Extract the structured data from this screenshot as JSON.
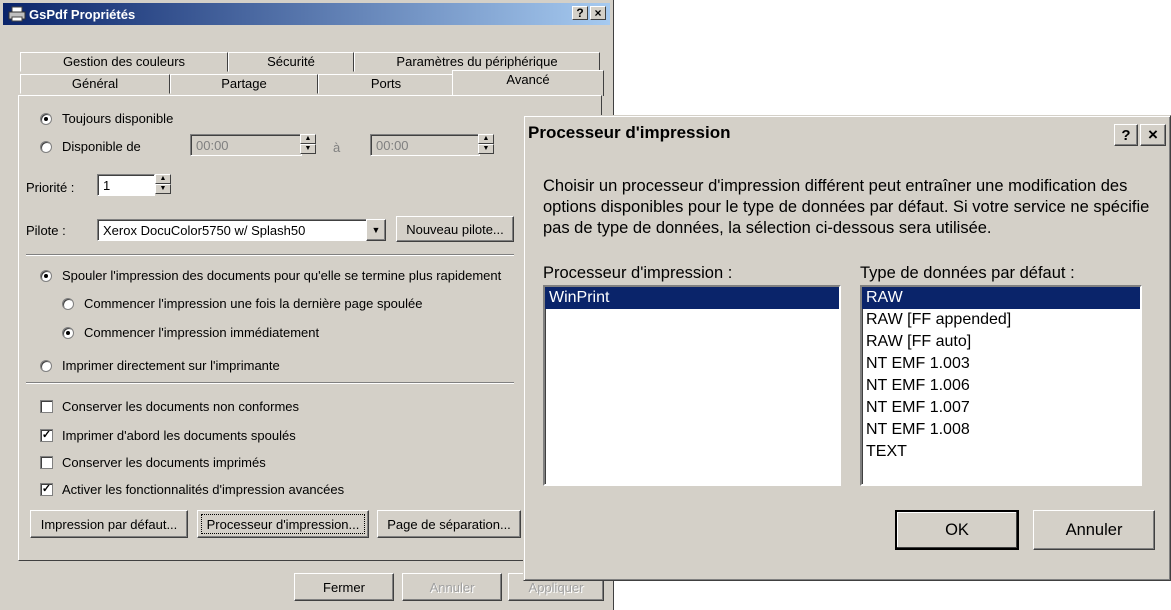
{
  "props": {
    "title": "GsPdf Propriétés",
    "help_btn": "?",
    "close_btn": "×",
    "tabs_row1": [
      "Gestion des couleurs",
      "Sécurité",
      "Paramètres du périphérique"
    ],
    "tabs_row2": [
      "Général",
      "Partage",
      "Ports",
      "Avancé"
    ],
    "always_available": "Toujours disponible",
    "available_from": "Disponible de",
    "time_from": "00:00",
    "time_to_label": "à",
    "time_to": "00:00",
    "priority_label": "Priorité :",
    "priority_value": "1",
    "driver_label": "Pilote :",
    "driver_value": "Xerox DocuColor5750 w/ Splash50",
    "new_driver_button": "Nouveau pilote...",
    "spool_option": "Spouler l'impression des documents pour qu'elle se termine plus rapidement",
    "spool_after_last": "Commencer l'impression une fois la dernière page spoulée",
    "spool_immediately": "Commencer l'impression immédiatement",
    "print_direct": "Imprimer directement sur l'imprimante",
    "keep_mismatched": "Conserver les documents non conformes",
    "print_spooled_first": "Imprimer d'abord les documents spoulés",
    "keep_printed": "Conserver les documents imprimés",
    "enable_advanced": "Activer les fonctionnalités d'impression avancées",
    "defaults_button": "Impression par défaut...",
    "processor_button": "Processeur d'impression...",
    "separator_button": "Page de séparation...",
    "close_button": "Fermer",
    "cancel_button": "Annuler",
    "apply_button": "Appliquer"
  },
  "proc": {
    "title": "Processeur d'impression",
    "help_btn": "?",
    "close_btn": "×",
    "description": "Choisir un processeur d'impression différent peut entraîner une modification des options disponibles pour le type de données par défaut. Si votre service ne spécifie pas de type de données, la sélection ci-dessous sera utilisée.",
    "processor_label": "Processeur d'impression :",
    "datatype_label": "Type de données par défaut :",
    "processors": [
      "WinPrint"
    ],
    "datatypes": [
      "RAW",
      "RAW [FF appended]",
      "RAW [FF auto]",
      "NT EMF 1.003",
      "NT EMF 1.006",
      "NT EMF 1.007",
      "NT EMF 1.008",
      "TEXT"
    ],
    "ok_button": "OK",
    "cancel_button": "Annuler"
  },
  "colors": {
    "titlebar_start": "#0a246a",
    "titlebar_end": "#a6caf0",
    "face": "#d4d0c8",
    "selection": "#0a246a"
  }
}
